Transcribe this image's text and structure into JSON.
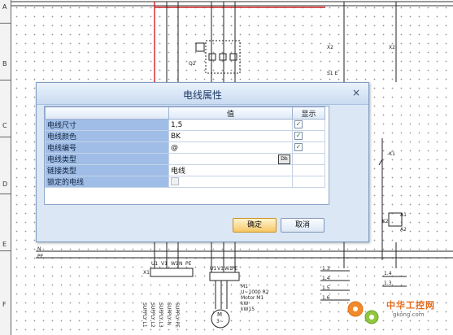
{
  "dialog": {
    "title": "电线属性",
    "close_glyph": "×",
    "columns": {
      "name": "",
      "value": "值",
      "show": "显示"
    },
    "rows": [
      {
        "name": "电线尺寸",
        "value": "1,5",
        "show": true
      },
      {
        "name": "电线颜色",
        "value": "BK",
        "show": true
      },
      {
        "name": "电线编号",
        "value": "@",
        "show": true
      },
      {
        "name": "电线类型",
        "value": "",
        "show": null,
        "extra_button": "Db"
      },
      {
        "name": "链接类型",
        "value": "电线",
        "show": null
      },
      {
        "name": "锁定的电线",
        "value": "",
        "show": false,
        "disabled_check": true
      }
    ],
    "ok_label": "确定",
    "cancel_label": "取消"
  },
  "schematic": {
    "row_letters": [
      "A",
      "B",
      "C",
      "D",
      "E",
      "F"
    ],
    "rail_n": "N",
    "rail_pe": "PE",
    "q2_label": "Q2",
    "x2_label": "X2",
    "x1_label": "X1",
    "s1_label": "S1 E",
    "k1_label": "-K1",
    "k2_label": "K2",
    "a1_label": "A1",
    "a2_label": "A2",
    "supply_labels": [
      "SUPPLY L1",
      "SUPPLY L2",
      "SUPPLY L3",
      "SUPPLY N",
      "SUPPLY PE"
    ],
    "terminal_labels": [
      "U1",
      "V1",
      "W1",
      "N",
      "PE"
    ],
    "motor_labels": [
      "U1",
      "V1",
      "W1",
      "PE"
    ],
    "motor_text": [
      "M1",
      "U~1000 R2",
      "Motor M1",
      "kW",
      "kW15"
    ],
    "motor_symbol": "M",
    "motor_phase": "3~",
    "right_contacts": [
      "1.3",
      "1.4",
      "1.5",
      "1.6"
    ],
    "right_contacts2": [
      "1.4",
      "1.3"
    ]
  },
  "watermark": {
    "text": "中华工控网",
    "url": "gkong.com",
    "color": "#e46a1b"
  }
}
